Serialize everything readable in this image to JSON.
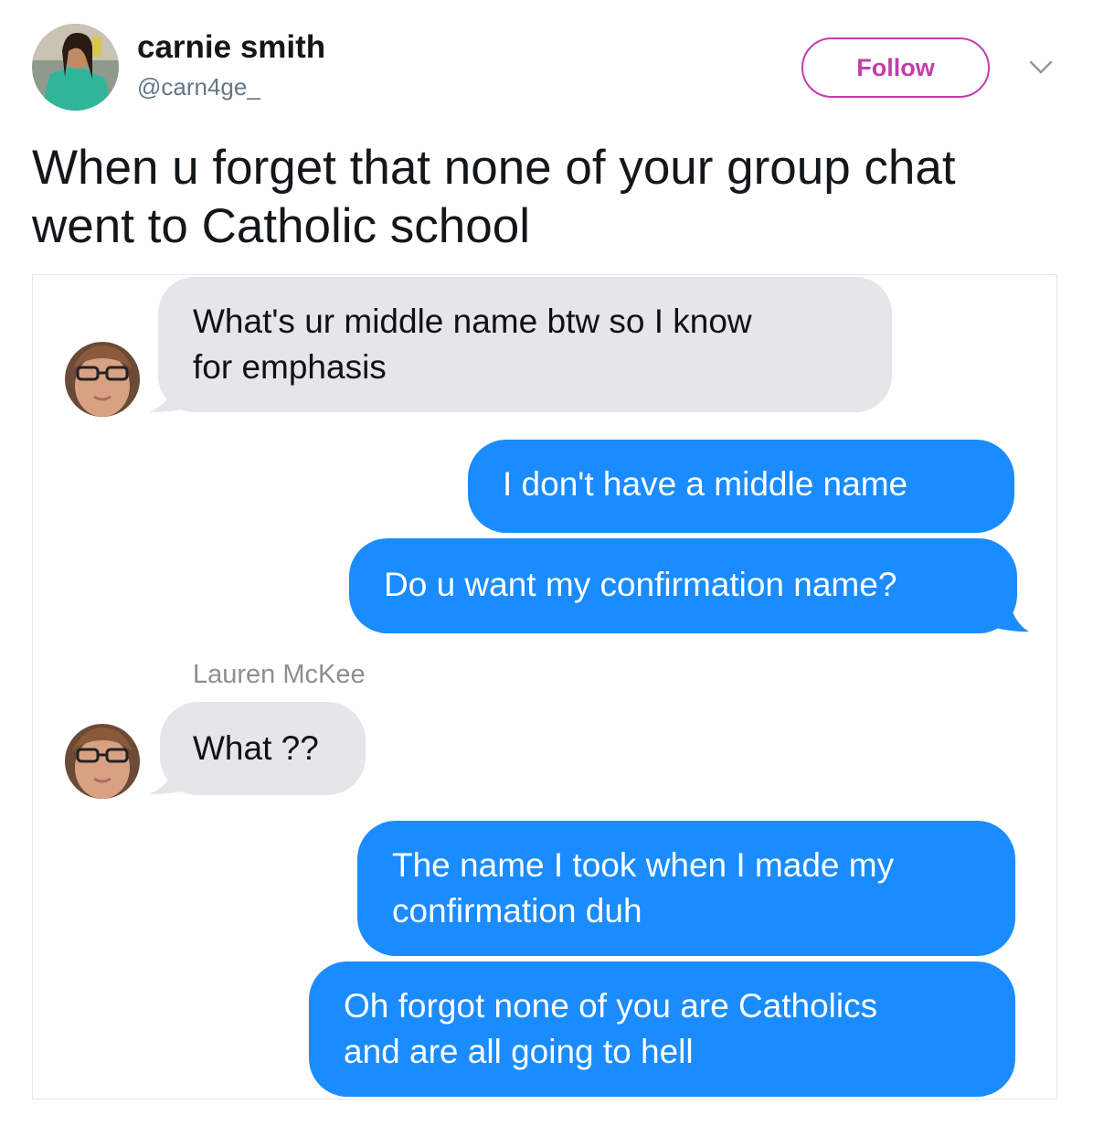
{
  "tweet": {
    "display_name": "carnie smith",
    "handle": "@carn4ge_",
    "follow_label": "Follow",
    "text_line1": "When u forget that none of your group chat",
    "text_line2": "went to Catholic school"
  },
  "chat": {
    "messages": [
      {
        "side": "left",
        "line1": "What's ur middle name btw so I know",
        "line2": "for emphasis"
      },
      {
        "side": "right",
        "line1": "I don't have a middle name"
      },
      {
        "side": "right",
        "line1": "Do u want my confirmation name?"
      },
      {
        "side": "left",
        "line1": "What ??"
      },
      {
        "side": "right",
        "line1": "The name I took when I made my",
        "line2": "confirmation duh"
      },
      {
        "side": "right",
        "line1": "Oh forgot none of you are Catholics",
        "line2": "and are all going to hell"
      }
    ],
    "sender_name": "Lauren McKee"
  },
  "colors": {
    "follow_accent": "#c33da8",
    "sent_bubble": "#1a8cff",
    "received_bubble": "#e5e5ea",
    "handle_gray": "#657786"
  },
  "icons": [
    "chevron-down-icon"
  ]
}
